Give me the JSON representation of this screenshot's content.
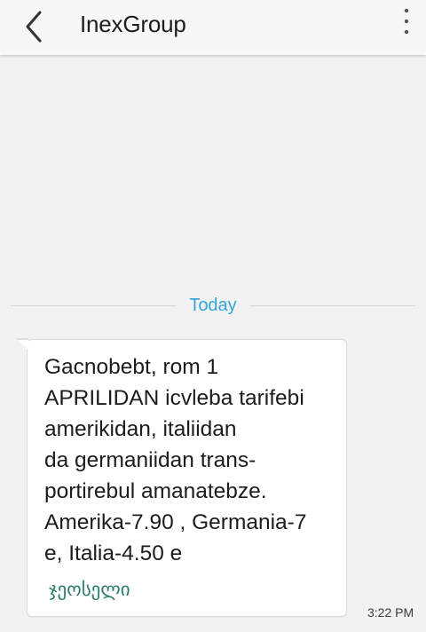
{
  "header": {
    "title": "InexGroup",
    "back_icon": "chevron-left-icon",
    "menu_icon": "more-vertical-icon"
  },
  "divider": {
    "date_label": "Today"
  },
  "message": {
    "lines": [
      "Gacnobebt, rom 1",
      "APRILIDAN icvleba tarifebi",
      "amerikidan, italiidan",
      "da germaniidan trans-",
      "portirebul amanatebze.",
      "Amerika-7.90 , Germania-7",
      "e, Italia-4.50 e"
    ],
    "signature": "ჯეოსელი",
    "time": "3:22 PM"
  },
  "colors": {
    "accent": "#37a4d9",
    "signature": "#2a7d6a",
    "background": "#f2f2f2",
    "bubble": "#ffffff"
  }
}
